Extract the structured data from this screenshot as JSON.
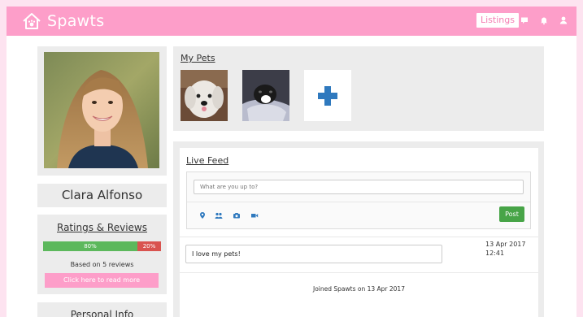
{
  "navbar": {
    "brand": "Spawts",
    "listings_label": "Listings",
    "icons": [
      "home-paw-icon",
      "chat-icon",
      "bell-icon",
      "user-icon"
    ],
    "colors": {
      "brand": "#fd9ec9",
      "accent": "#f57fb3"
    }
  },
  "profile": {
    "name": "Clara Alfonso",
    "photo": "profile-photo"
  },
  "ratings": {
    "title": "Ratings & Reviews",
    "positive": {
      "label": "80%",
      "value": 80
    },
    "negative": {
      "label": "20%",
      "value": 20
    },
    "based_on": "Based on 5 reviews",
    "read_more": "Click here to read more"
  },
  "personal": {
    "title": "Personal Info"
  },
  "pets": {
    "title": "My Pets",
    "items": [
      "white-dog-photo",
      "black-white-puppy-photo"
    ],
    "add_icon": "plus-icon"
  },
  "feed": {
    "title": "Live Feed",
    "placeholder": "What are you up to?",
    "tools": [
      "location-icon",
      "people-icon",
      "camera-icon",
      "video-icon"
    ],
    "post_label": "Post",
    "entries": [
      {
        "text": "I love my pets!",
        "date": "13 Apr 2017",
        "time": "12:41"
      }
    ],
    "joined": "Joined Spawts on 13 Apr 2017"
  }
}
